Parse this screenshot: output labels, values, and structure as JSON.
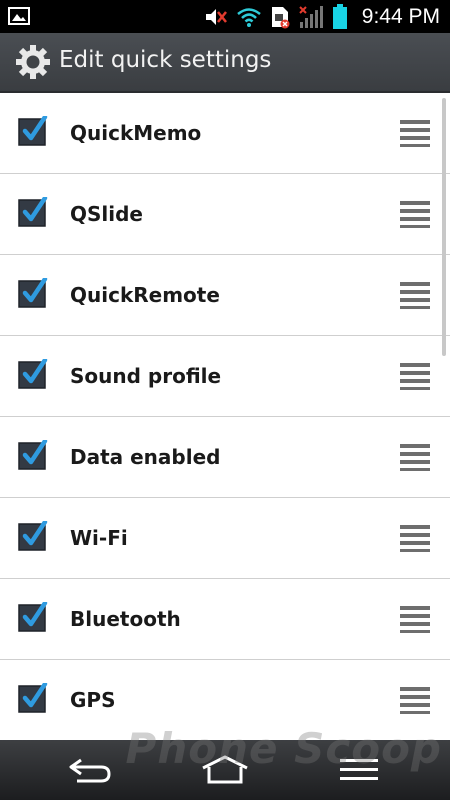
{
  "status_bar": {
    "time": "9:44 PM",
    "icons": [
      "picture-icon",
      "muted-volume-icon",
      "wifi-icon",
      "sim-error-icon",
      "signal-icon",
      "battery-icon"
    ]
  },
  "header": {
    "title": "Edit quick settings",
    "icon": "gear-icon"
  },
  "settings": [
    {
      "label": "QuickMemo",
      "checked": true
    },
    {
      "label": "QSlide",
      "checked": true
    },
    {
      "label": "QuickRemote",
      "checked": true
    },
    {
      "label": "Sound profile",
      "checked": true
    },
    {
      "label": "Data enabled",
      "checked": true
    },
    {
      "label": "Wi-Fi",
      "checked": true
    },
    {
      "label": "Bluetooth",
      "checked": true
    },
    {
      "label": "GPS",
      "checked": true
    }
  ],
  "nav": {
    "buttons": [
      "back-icon",
      "home-icon",
      "menu-icon"
    ]
  },
  "watermark": "Phone Scoop",
  "colors": {
    "check_accent": "#2f9be0",
    "battery": "#19d4e6",
    "mute_red": "#e23b2e"
  }
}
